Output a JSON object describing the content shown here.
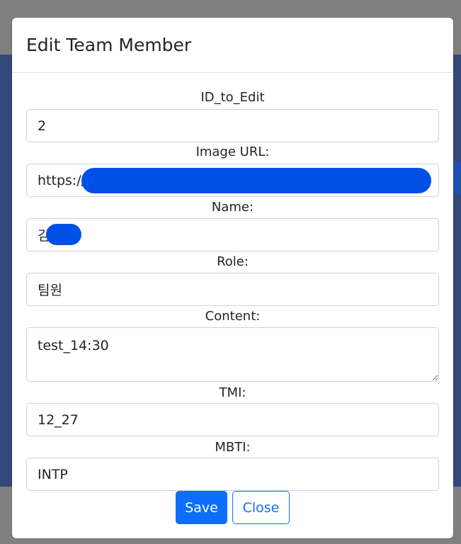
{
  "modal": {
    "title": "Edit Team Member",
    "fields": {
      "id": {
        "label": "ID_to_Edit",
        "value": "2"
      },
      "image_url": {
        "label": "Image URL:",
        "value": "https://"
      },
      "name": {
        "label": "Name:",
        "value": "김"
      },
      "role": {
        "label": "Role:",
        "value": "팀원"
      },
      "content": {
        "label": "Content:",
        "value": "test_14:30"
      },
      "tmi": {
        "label": "TMI:",
        "value": "12_27"
      },
      "mbti": {
        "label": "MBTI:",
        "value": "INTP"
      }
    },
    "buttons": {
      "save": "Save",
      "close": "Close"
    }
  },
  "colors": {
    "primary": "#0d6efd",
    "backdrop": "#7f7f7f",
    "page_band": "#33497a",
    "redaction": "#0050e6"
  }
}
